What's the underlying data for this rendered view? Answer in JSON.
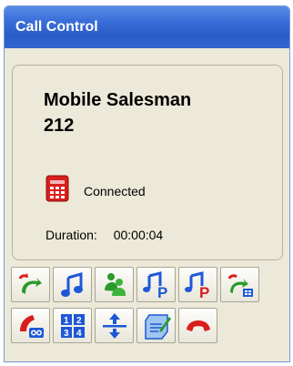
{
  "window": {
    "title": "Call Control"
  },
  "call": {
    "name": "Mobile Salesman",
    "extension": "212",
    "status": "Connected",
    "duration_label": "Duration:",
    "duration_value": "00:00:04"
  },
  "toolbar_row1": [
    "transfer-icon",
    "music-hold-icon",
    "conference-icon",
    "park-icon",
    "park-retrieve-icon",
    "retrieve-icon"
  ],
  "toolbar_row2": [
    "voicemail-icon",
    "keypad-icon",
    "split-icon",
    "notes-icon",
    "hangup-icon"
  ],
  "colors": {
    "titlebar": "#2a5cc8",
    "panel_bg": "#ece9d8",
    "phone_red": "#d81e1e",
    "button_green": "#2c9a2c",
    "button_blue": "#1e58d8",
    "button_red": "#d81e1e"
  }
}
